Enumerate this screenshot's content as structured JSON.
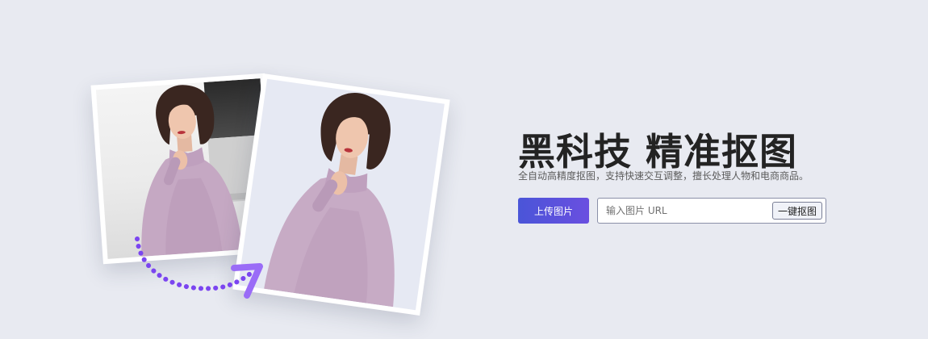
{
  "hero": {
    "title": "黑科技 精准抠图",
    "subtitle": "全自动高精度抠图，支持快速交互调整，擅长处理人物和电商商品。",
    "upload_label": "上传图片",
    "url_placeholder": "输入图片 URL",
    "cutout_label": "一键抠图"
  },
  "colors": {
    "background": "#e8eaf1",
    "accent_start": "#4a55d8",
    "accent_end": "#6a4fe0",
    "arrow": "#7b45f0"
  },
  "icons": {
    "arrow": "curved-dotted-arrow-icon"
  }
}
